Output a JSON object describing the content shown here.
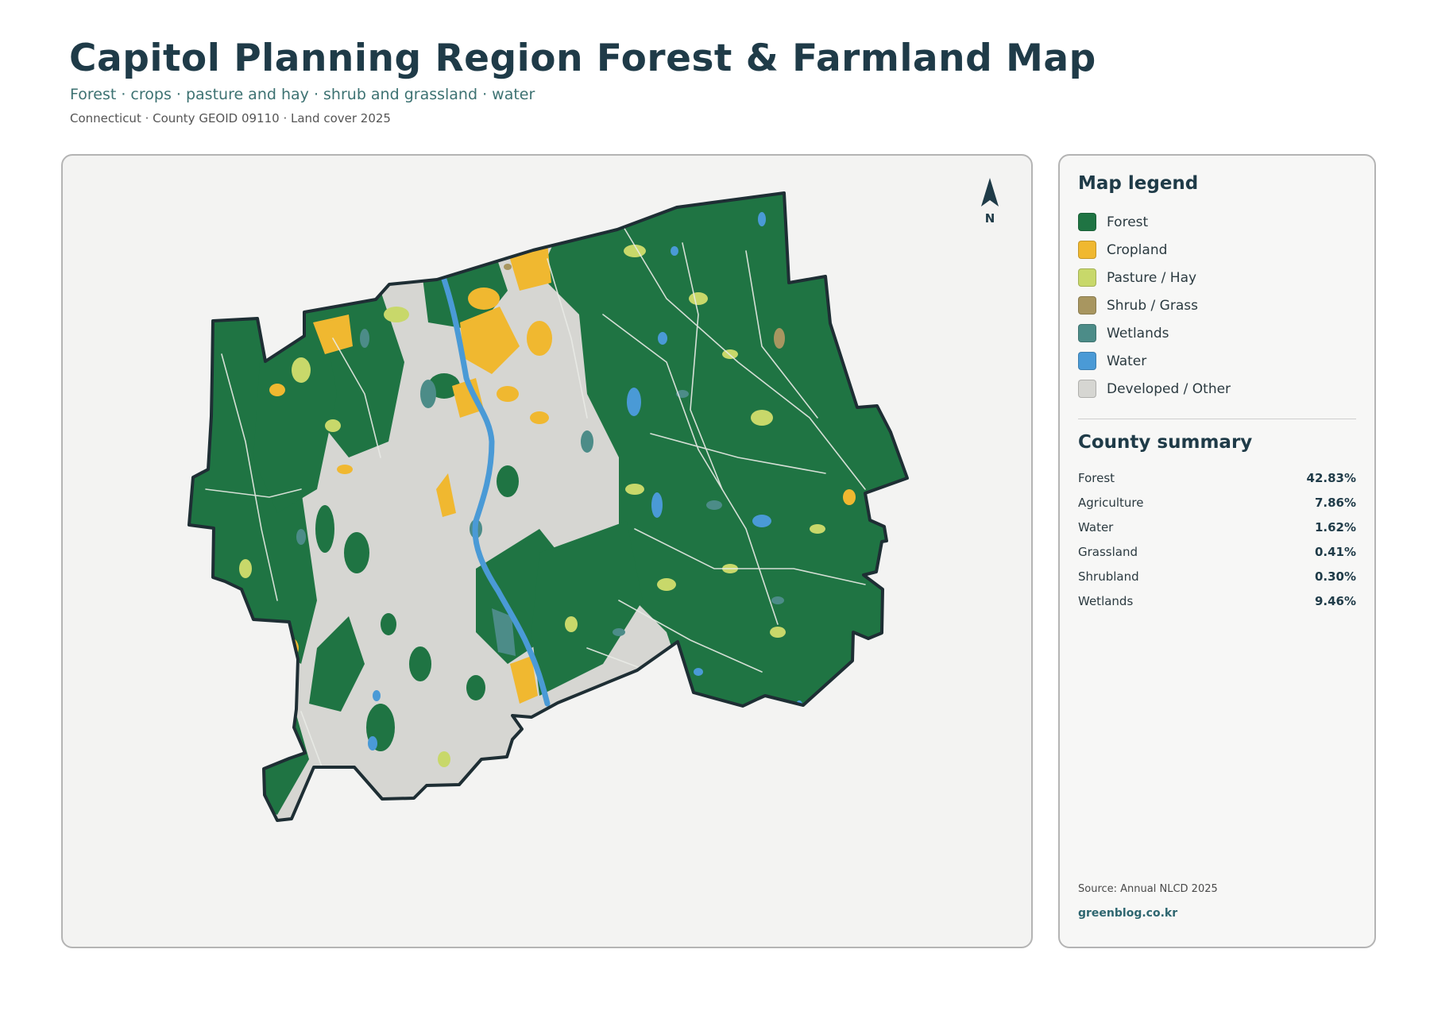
{
  "header": {
    "title": "Capitol Planning Region Forest & Farmland Map",
    "subtitle": "Forest · crops · pasture and hay · shrub and grassland · water",
    "meta": "Connecticut · County GEOID 09110 · Land cover 2025"
  },
  "map": {
    "north_label": "N",
    "colors": {
      "forest": "#1f7443",
      "cropland": "#f0b830",
      "pasture": "#c8d86a",
      "shrub": "#a89660",
      "wetlands": "#4c8c88",
      "water": "#4a9ad6",
      "developed": "#d6d6d2",
      "boundary": "#1e2e34",
      "panel_bg": "#f3f3f2"
    }
  },
  "legend": {
    "title": "Map legend",
    "items": [
      {
        "label": "Forest",
        "color": "#1f7443"
      },
      {
        "label": "Cropland",
        "color": "#f0b830"
      },
      {
        "label": "Pasture / Hay",
        "color": "#c8d86a"
      },
      {
        "label": "Shrub / Grass",
        "color": "#a89660"
      },
      {
        "label": "Wetlands",
        "color": "#4c8c88"
      },
      {
        "label": "Water",
        "color": "#4a9ad6"
      },
      {
        "label": "Developed / Other",
        "color": "#d6d6d2"
      }
    ]
  },
  "summary": {
    "title": "County summary",
    "rows": [
      {
        "label": "Forest",
        "value": "42.83%"
      },
      {
        "label": "Agriculture",
        "value": "7.86%"
      },
      {
        "label": "Water",
        "value": "1.62%"
      },
      {
        "label": "Grassland",
        "value": "0.41%"
      },
      {
        "label": "Shrubland",
        "value": "0.30%"
      },
      {
        "label": "Wetlands",
        "value": "9.46%"
      }
    ]
  },
  "footer": {
    "source": "Source: Annual NLCD 2025",
    "site": "greenblog.co.kr"
  }
}
